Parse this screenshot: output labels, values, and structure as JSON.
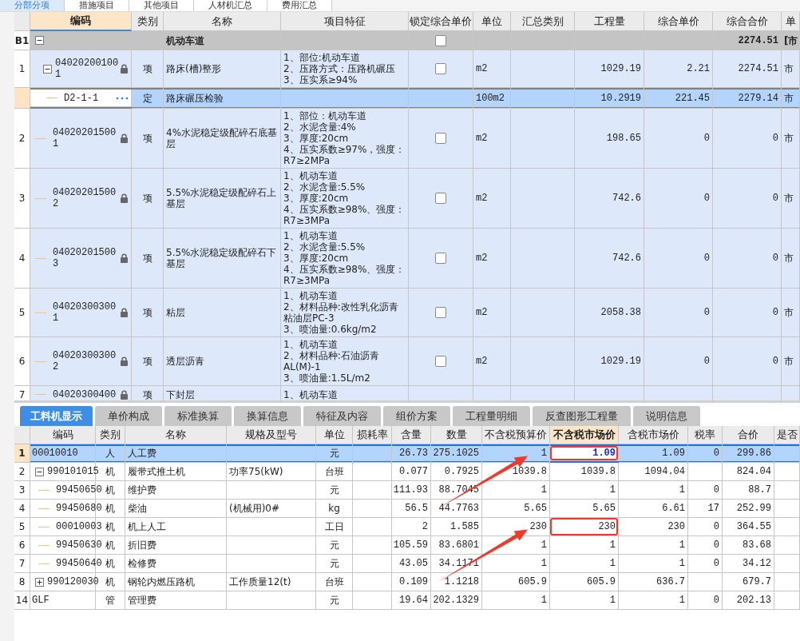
{
  "top_tabs": [
    {
      "label": "分部分项",
      "selected": true
    },
    {
      "label": "措施项目",
      "selected": false
    },
    {
      "label": "其他项目",
      "selected": false
    },
    {
      "label": "人材机汇总",
      "selected": false
    },
    {
      "label": "费用汇总",
      "selected": false
    }
  ],
  "bill_table": {
    "columns": [
      {
        "label": "编码",
        "selected": true
      },
      {
        "label": "类别",
        "selected": false
      },
      {
        "label": "名称",
        "selected": false
      },
      {
        "label": "项目特征",
        "selected": false
      },
      {
        "label": "锁定综合单价",
        "selected": false
      },
      {
        "label": "单位",
        "selected": false
      },
      {
        "label": "汇总类别",
        "selected": false
      },
      {
        "label": "工程量",
        "selected": false
      },
      {
        "label": "综合单价",
        "selected": false
      },
      {
        "label": "综合合价",
        "selected": false
      },
      {
        "label": "单",
        "selected": false
      }
    ],
    "section": {
      "number": "B1",
      "expanded": true,
      "name": "机动车道",
      "price_locked": false,
      "total": "2274.51",
      "column_12": "[市",
      "children": [
        {
          "kind": "item",
          "number": "1",
          "code": "040202001001",
          "expanded": true,
          "type": "项",
          "name": "路床(槽)整形",
          "features": [
            "1、部位:机动车道",
            "2、压路方式：压路机碾压",
            "3、压实系≥94%"
          ],
          "price_locked": false,
          "unit": "m2",
          "quantity": "1029.19",
          "unit_price": "2.21",
          "total": "2274.51",
          "column_12": "市",
          "selected": false,
          "children": [
            {
              "kind": "quota",
              "code": "D2-1-1",
              "type": "定",
              "name": "路床碾压检验",
              "unit": "100m2",
              "quantity": "10.2919",
              "unit_price": "221.45",
              "total": "2279.14",
              "column_12": "市",
              "selected": true
            }
          ]
        },
        {
          "kind": "item",
          "number": "2",
          "code": "040202015001",
          "type": "项",
          "name": "4%水泥稳定级配碎石底基层",
          "features": [
            "1、部位：机动车道",
            "2、水泥含量:4%",
            "3、厚度:20cm",
            "4、压实系数≥97%，强度：R7≥2MPa"
          ],
          "price_locked": false,
          "unit": "m2",
          "quantity": "198.65",
          "unit_price": "0",
          "total": "0",
          "column_12": "市",
          "selected": false
        },
        {
          "kind": "item",
          "number": "3",
          "code": "040202015002",
          "type": "项",
          "name": "5.5%水泥稳定级配碎石上基层",
          "features": [
            "1、机动车道",
            "2、水泥含量:5.5%",
            "3、厚度:20cm",
            "4、压实系数≥98%、强度：R7≥3MPa"
          ],
          "price_locked": false,
          "unit": "m2",
          "quantity": "742.6",
          "unit_price": "0",
          "total": "0",
          "column_12": "市",
          "selected": false
        },
        {
          "kind": "item",
          "number": "4",
          "code": "040202015003",
          "type": "项",
          "name": "5.5%水泥稳定级配碎石下基层",
          "features": [
            "1、机动车道",
            "2、水泥含量:5.5%",
            "3、厚度:20cm",
            "4、压实系数≥98%、强度：R7≥3MPa"
          ],
          "price_locked": false,
          "unit": "m2",
          "quantity": "742.6",
          "unit_price": "0",
          "total": "0",
          "column_12": "市",
          "selected": false
        },
        {
          "kind": "item",
          "number": "5",
          "code": "040203003001",
          "type": "项",
          "name": "粘层",
          "features": [
            "1、机动车道",
            "2、材料品种:改性乳化沥青粘油层PC-3",
            "3、喷油量:0.6kg/m2"
          ],
          "price_locked": false,
          "unit": "m2",
          "quantity": "2058.38",
          "unit_price": "0",
          "total": "0",
          "column_12": "市",
          "selected": false
        },
        {
          "kind": "item",
          "number": "6",
          "code": "040203003002",
          "type": "项",
          "name": "透层沥青",
          "features": [
            "1、机动车道",
            "2、材料品种:石油沥青AL(M)-1",
            "3、喷油量:1.5L/m2"
          ],
          "price_locked": false,
          "unit": "m2",
          "quantity": "1029.19",
          "unit_price": "0",
          "total": "0",
          "column_12": "市",
          "selected": false
        },
        {
          "kind": "item",
          "number": "7",
          "code": "04020300400",
          "type": "项",
          "name": "下封层",
          "features": [
            "1、机动车道"
          ],
          "selected": false
        }
      ]
    }
  },
  "detail_tabs": [
    {
      "label": "工料机显示",
      "selected": true
    },
    {
      "label": "单价构成",
      "selected": false
    },
    {
      "label": "标准换算",
      "selected": false
    },
    {
      "label": "换算信息",
      "selected": false
    },
    {
      "label": "特征及内容",
      "selected": false
    },
    {
      "label": "组价方案",
      "selected": false
    },
    {
      "label": "工程量明细",
      "selected": false
    },
    {
      "label": "反查图形工程量",
      "selected": false
    },
    {
      "label": "说明信息",
      "selected": false
    }
  ],
  "resource_table": {
    "columns": [
      {
        "label": "编码",
        "selected": false
      },
      {
        "label": "类别",
        "selected": false
      },
      {
        "label": "名称",
        "selected": false
      },
      {
        "label": "规格及型号",
        "selected": false
      },
      {
        "label": "单位",
        "selected": false
      },
      {
        "label": "损耗率",
        "selected": false
      },
      {
        "label": "含量",
        "selected": false
      },
      {
        "label": "数量",
        "selected": false
      },
      {
        "label": "不含税预算价",
        "selected": false
      },
      {
        "label": "不含税市场价",
        "selected": true
      },
      {
        "label": "含税市场价",
        "selected": false
      },
      {
        "label": "税率",
        "selected": false
      },
      {
        "label": "合价",
        "selected": false
      },
      {
        "label": "是否",
        "selected": false
      }
    ],
    "rows": [
      {
        "number": "1",
        "code": "00010010",
        "type": "人",
        "name": "人工费",
        "unit": "元",
        "content": "26.73",
        "quantity": "275.1025",
        "budget_price": "1",
        "market_price": "1.09",
        "tax_market_price": "1.09",
        "tax_rate": "0",
        "total": "299.86",
        "selected": true,
        "marked": true,
        "arrow_start": false,
        "arrow_end": true
      },
      {
        "number": "2",
        "code": "990101015",
        "expanded": true,
        "type": "机",
        "name": "履带式推土机",
        "spec": "功率75(kW)",
        "unit": "台班",
        "content": "0.077",
        "quantity": "0.7925",
        "budget_price": "1039.8",
        "market_price": "1039.8",
        "tax_market_price": "1094.04",
        "total": "824.04",
        "selected": false,
        "marked": false,
        "arrow_start": false,
        "arrow_end": false,
        "children": [
          {
            "number": "3",
            "code": "99450650",
            "type": "机",
            "name": "维护费",
            "unit": "元",
            "content": "111.93",
            "quantity": "88.7045",
            "budget_price": "1",
            "market_price": "1",
            "tax_market_price": "1",
            "tax_rate": "0",
            "total": "88.7",
            "selected": false,
            "marked": false,
            "arrow_start": false,
            "arrow_end": false
          },
          {
            "number": "4",
            "code": "99450680",
            "type": "机",
            "name": "柴油",
            "spec": "(机械用)0#",
            "unit": "kg",
            "content": "56.5",
            "quantity": "44.7763",
            "budget_price": "5.65",
            "market_price": "5.65",
            "tax_market_price": "6.61",
            "tax_rate": "17",
            "total": "252.99",
            "selected": false,
            "marked": false,
            "arrow_start": true,
            "arrow_end": false
          },
          {
            "number": "5",
            "code": "00010003",
            "type": "机",
            "name": "机上人工",
            "unit": "工日",
            "content": "2",
            "quantity": "1.585",
            "budget_price": "230",
            "market_price": "230",
            "tax_market_price": "230",
            "tax_rate": "0",
            "total": "364.55",
            "selected": false,
            "marked": true,
            "arrow_start": false,
            "arrow_end": true
          },
          {
            "number": "6",
            "code": "99450630",
            "type": "机",
            "name": "折旧费",
            "unit": "元",
            "content": "105.59",
            "quantity": "83.6801",
            "budget_price": "1",
            "market_price": "1",
            "tax_market_price": "1",
            "tax_rate": "0",
            "total": "83.68",
            "selected": false,
            "marked": false,
            "arrow_start": false,
            "arrow_end": false
          },
          {
            "number": "7",
            "code": "99450640",
            "type": "机",
            "name": "检修费",
            "unit": "元",
            "content": "43.05",
            "quantity": "34.1171",
            "budget_price": "1",
            "market_price": "1",
            "tax_market_price": "1",
            "tax_rate": "0",
            "total": "34.12",
            "selected": false,
            "marked": false,
            "arrow_start": false,
            "arrow_end": false
          }
        ]
      },
      {
        "number": "8",
        "code": "990120030",
        "expanded": false,
        "type": "机",
        "name": "钢轮内燃压路机",
        "spec": "工作质量12(t)",
        "unit": "台班",
        "content": "0.109",
        "quantity": "1.1218",
        "budget_price": "605.9",
        "market_price": "605.9",
        "tax_market_price": "636.7",
        "total": "679.7",
        "selected": false,
        "marked": false,
        "arrow_start": true,
        "arrow_end": false
      },
      {
        "number": "14",
        "code": "GLF",
        "type": "管",
        "name": "管理费",
        "unit": "元",
        "content": "19.64",
        "quantity": "202.1329",
        "budget_price": "1",
        "market_price": "1",
        "tax_market_price": "1",
        "tax_rate": "0",
        "total": "202.13",
        "selected": false,
        "marked": false,
        "arrow_start": false,
        "arrow_end": false
      }
    ]
  }
}
